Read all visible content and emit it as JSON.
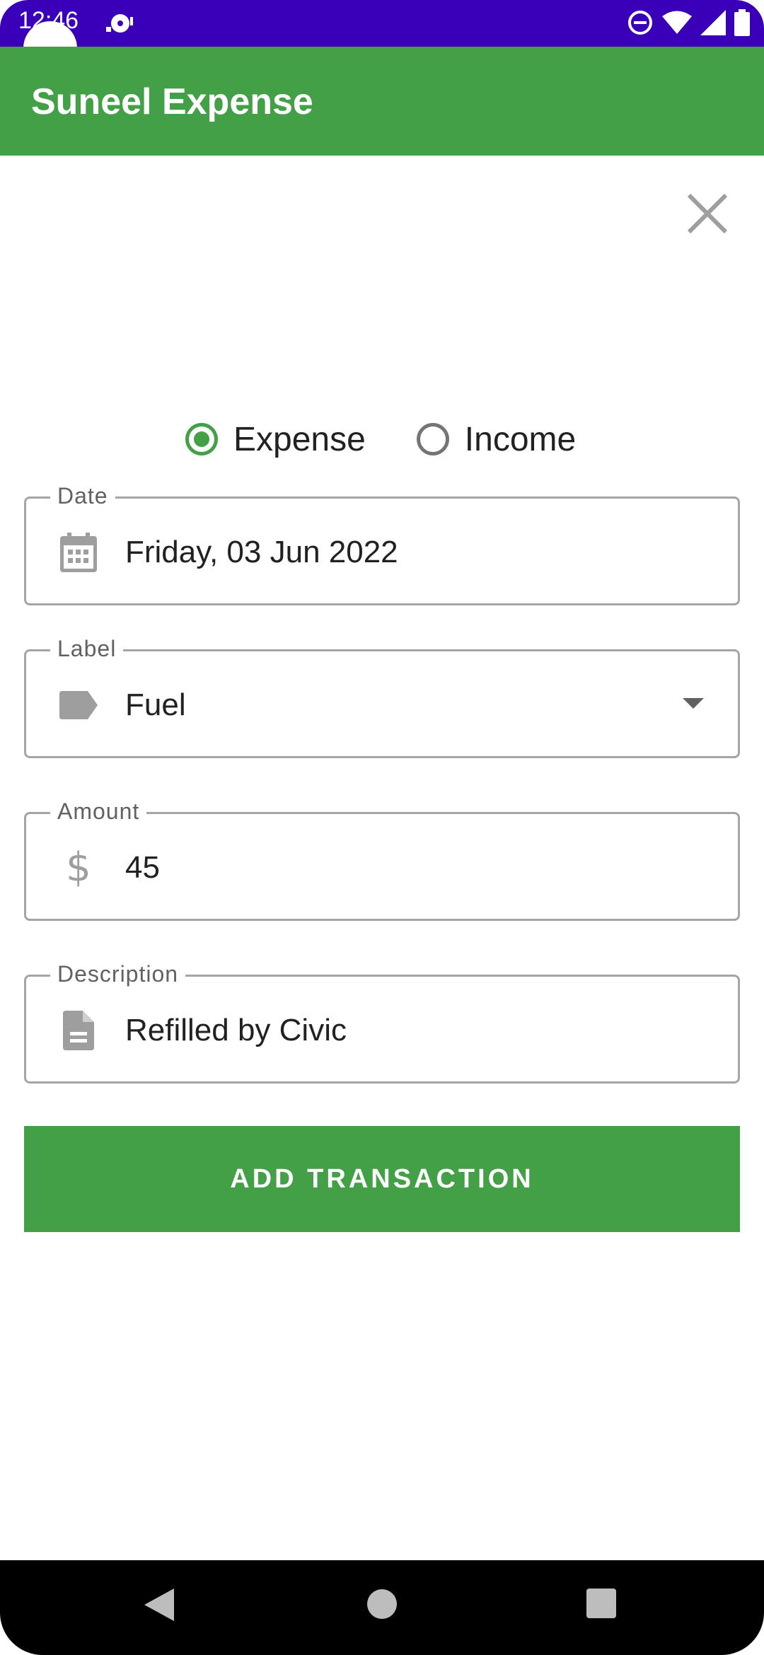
{
  "status_bar": {
    "time": "12:46"
  },
  "app_bar": {
    "title": "Suneel Expense"
  },
  "form": {
    "close_icon": "close-icon",
    "type_options": [
      {
        "label": "Expense",
        "selected": true
      },
      {
        "label": "Income",
        "selected": false
      }
    ],
    "date": {
      "label": "Date",
      "value": "Friday, 03 Jun 2022",
      "icon": "calendar-icon"
    },
    "category": {
      "label": "Label",
      "value": "Fuel",
      "icon": "tag-icon"
    },
    "amount": {
      "label": "Amount",
      "value": "45",
      "icon": "dollar-icon"
    },
    "description": {
      "label": "Description",
      "value": "Refilled by Civic",
      "icon": "document-icon"
    },
    "submit_label": "ADD TRANSACTION"
  },
  "colors": {
    "status_bar": "#3a00b8",
    "app_bar": "#43a047",
    "accent": "#43a047",
    "outline": "#a5a5a5"
  }
}
